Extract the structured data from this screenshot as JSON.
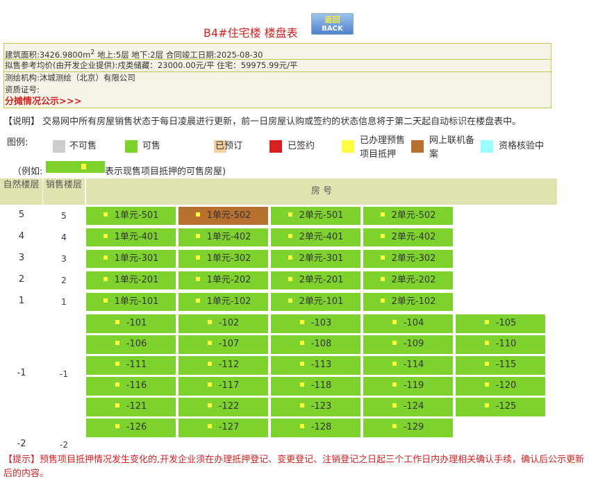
{
  "title": "B4#住宅楼  楼盘表",
  "back_button": {
    "cn": "返回",
    "en": "BACK"
  },
  "info": {
    "line1": "建筑面积:3426.9800m",
    "sup": "2",
    "line1b": " 地上:5层  地下:2层  合同竣工日期:2025-08-30",
    "line2": "拟售参考均价(由开发企业提供):戍类储藏：23000.00元/平 住宅：59975.99元/平",
    "line3": "测绘机构:沐城测绘（北京）有限公司",
    "line4": "资质证号:",
    "link": "分摊情况公示>>>"
  },
  "note": "【说明】 交易网中所有房屋销售状态于每日凌晨进行更新，前一日房屋认购或签约的状态信息将于第二天起自动标识在楼盘表中。",
  "legend": {
    "label": "图例:",
    "items": [
      {
        "label": "不可售",
        "color": "#cccccc"
      },
      {
        "label": "可售",
        "color": "#7ed22e"
      },
      {
        "label": "已预订",
        "color": "#f0cfa0"
      },
      {
        "label": "已签约",
        "color": "#d82020"
      },
      {
        "label": "已办理预售项目抵押",
        "color": "#ffff40"
      },
      {
        "label": "网上联机备案",
        "color": "#b87030"
      },
      {
        "label": "资格核验中",
        "color": "#99ffff"
      }
    ]
  },
  "example": {
    "prefix": "（例如:",
    "suffix": "表示现售项目抵押的可售房屋)"
  },
  "table": {
    "h1": "自然楼层",
    "h2": "销售楼层",
    "h3": "房 号"
  },
  "colors": {
    "available": "#7ed22e",
    "filed": "#b87030",
    "mortgage": "#ffff40"
  },
  "floors": [
    {
      "natural": "5",
      "sale": "5",
      "rooms": [
        {
          "n": "1单元-501",
          "s": "available"
        },
        {
          "n": "1单元-502",
          "s": "filed"
        },
        {
          "n": "2单元-501",
          "s": "available"
        },
        {
          "n": "2单元-502",
          "s": "available"
        }
      ]
    },
    {
      "natural": "4",
      "sale": "4",
      "rooms": [
        {
          "n": "1单元-401",
          "s": "available"
        },
        {
          "n": "1单元-402",
          "s": "available"
        },
        {
          "n": "2单元-401",
          "s": "available"
        },
        {
          "n": "2单元-402",
          "s": "available"
        }
      ]
    },
    {
      "natural": "3",
      "sale": "3",
      "rooms": [
        {
          "n": "1单元-301",
          "s": "available"
        },
        {
          "n": "1单元-302",
          "s": "available"
        },
        {
          "n": "2单元-301",
          "s": "available"
        },
        {
          "n": "2单元-302",
          "s": "available"
        }
      ]
    },
    {
      "natural": "2",
      "sale": "2",
      "rooms": [
        {
          "n": "1单元-201",
          "s": "available"
        },
        {
          "n": "1单元-202",
          "s": "available"
        },
        {
          "n": "2单元-201",
          "s": "available"
        },
        {
          "n": "2单元-202",
          "s": "available"
        }
      ]
    },
    {
      "natural": "1",
      "sale": "1",
      "rooms": [
        {
          "n": "1单元-101",
          "s": "available"
        },
        {
          "n": "1单元-102",
          "s": "available"
        },
        {
          "n": "2单元-101",
          "s": "available"
        },
        {
          "n": "2单元-102",
          "s": "available"
        }
      ]
    },
    {
      "natural": "-1",
      "sale": "-1",
      "rooms": [
        "-101",
        "-102",
        "-103",
        "-104",
        "-105",
        "-106",
        "-107",
        "-108",
        "-109",
        "-110",
        "-111",
        "-112",
        "-113",
        "-114",
        "-115",
        "-116",
        "-117",
        "-118",
        "-119",
        "-120",
        "-121",
        "-122",
        "-123",
        "-124",
        "-125",
        "-126",
        "-127",
        "-128",
        "-129"
      ]
    },
    {
      "natural": "-2",
      "sale": "-2",
      "rooms": []
    }
  ],
  "tip": "【提示】预售项目抵押情况发生变化的,开发企业须在办理抵押登记、变更登记、注销登记之日起三个工作日内办理相关确认手续，确认后公示更新后的内容。"
}
